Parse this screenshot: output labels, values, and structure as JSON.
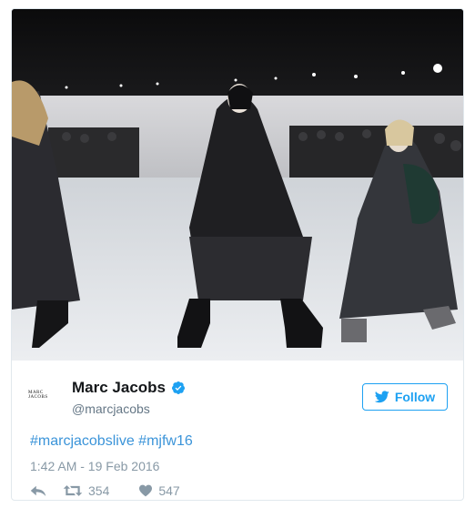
{
  "tweet": {
    "account": {
      "display_name": "Marc Jacobs",
      "handle": "@marcjacobs",
      "avatar_text": "MARC JACOBS",
      "verified_icon": "verified-badge-icon"
    },
    "follow_label": "Follow",
    "hashtags": [
      "#marcjacobslive",
      "#mjfw16"
    ],
    "timestamp": "1:42 AM - 19 Feb 2016",
    "retweet_count": "354",
    "like_count": "547"
  },
  "media": {
    "description_icon": "runway-photo"
  },
  "colors": {
    "twitter_blue": "#1da1f2",
    "link_blue": "#3b94d9",
    "muted_gray": "#8899a6",
    "name_black": "#14171a"
  }
}
